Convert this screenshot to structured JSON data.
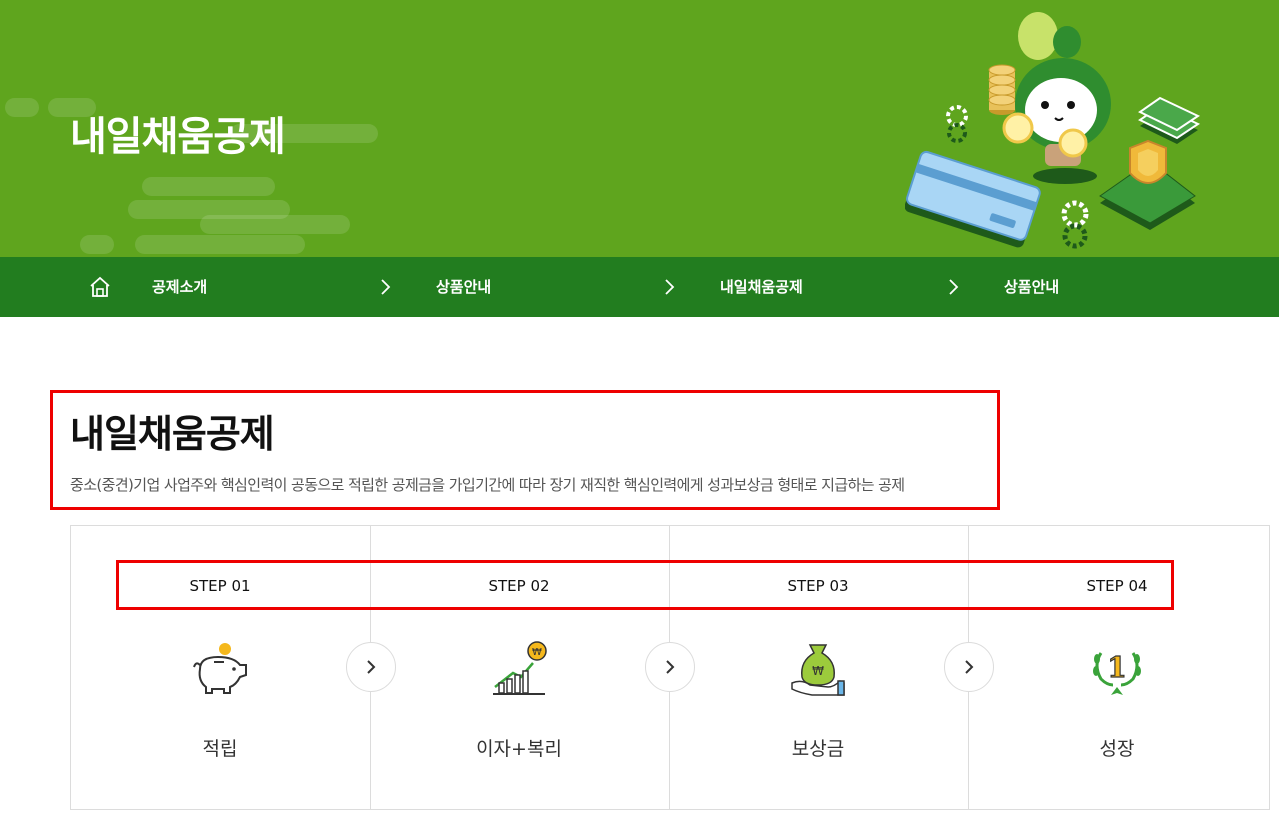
{
  "hero": {
    "title": "내일채움공제"
  },
  "breadcrumb": {
    "home_icon": "home-icon",
    "items": [
      "공제소개",
      "상품안내",
      "내일채움공제",
      "상품안내"
    ]
  },
  "intro": {
    "title": "내일채움공제",
    "description": "중소(중견)기업 사업주와 핵심인력이 공동으로 적립한 공제금을 가입기간에 따라 장기 재직한 핵심인력에게 성과보상금 형태로 지급하는 공제"
  },
  "steps": [
    {
      "label": "STEP 01",
      "name": "적립",
      "icon": "piggy-bank-icon"
    },
    {
      "label": "STEP 02",
      "name": "이자+복리",
      "icon": "growth-chart-icon"
    },
    {
      "label": "STEP 03",
      "name": "보상금",
      "icon": "money-bag-hand-icon"
    },
    {
      "label": "STEP 04",
      "name": "성장",
      "icon": "first-place-laurel-icon"
    }
  ],
  "colors": {
    "hero_green": "#5fa51e",
    "crumb_green": "#227d1f",
    "highlight_red": "#ee0000"
  }
}
